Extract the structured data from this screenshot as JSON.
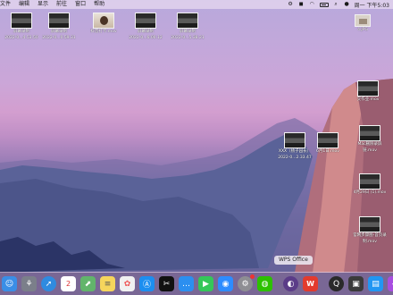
{
  "menubar": {
    "items": [
      "文件",
      "编辑",
      "显示",
      "前往",
      "窗口",
      "帮助"
    ],
    "clock": "周一 下午5:03"
  },
  "desktop_icons": [
    {
      "label1": "屏幕录制",
      "label2": "2022-0...4.53.50",
      "kind": "dark"
    },
    {
      "label1": "屏幕录制",
      "label2": "2022-0...0.59.31",
      "kind": "dark"
    },
    {
      "label1": "",
      "label2": "抖音打卡.mov",
      "kind": "face"
    },
    {
      "label1": "屏幕录制",
      "label2": "2022-0...6.00.12",
      "kind": "dark"
    },
    {
      "label1": "屏幕录制",
      "label2": "2022-0...5.38.21",
      "kind": "dark"
    },
    {
      "label1": "",
      "label2": "4.JPG",
      "kind": "img"
    },
    {
      "label1": "",
      "label2": "交作业.mov",
      "kind": "dark"
    },
    {
      "label1": "XXX（杨子园长）",
      "label2": "2022-0...2.33.47",
      "kind": "dark"
    },
    {
      "label1": "6月1日.mov",
      "label2": "",
      "kind": "dark"
    },
    {
      "label1": "Mac删除录屏",
      "label2": "链.mov",
      "kind": "dark"
    },
    {
      "label1": "",
      "label2": "4月29日 (1).mov",
      "kind": "dark"
    },
    {
      "label1": "官网步骤图-首页录",
      "label2": "制.mov",
      "kind": "dark"
    }
  ],
  "dock": {
    "tooltip": "WPS Office",
    "calendar_day": "2",
    "apps": [
      {
        "name": "finder",
        "color": "#3a8ee6"
      },
      {
        "name": "launchpad",
        "color": "#7b7f8a"
      },
      {
        "name": "safari",
        "color": "#2f8be0"
      },
      {
        "name": "calendar",
        "color": "#ffffff"
      },
      {
        "name": "maps",
        "color": "#62b56b"
      },
      {
        "name": "notes",
        "color": "#f6d55c"
      },
      {
        "name": "photos",
        "color": "#f0f0f0"
      },
      {
        "name": "app-store",
        "color": "#1c8ef0"
      },
      {
        "name": "capcut",
        "color": "#111111"
      },
      {
        "name": "messages-dots",
        "color": "#2b8ff0"
      },
      {
        "name": "facetime",
        "color": "#34c759"
      },
      {
        "name": "zoom",
        "color": "#2d8cff"
      },
      {
        "name": "system-preferences",
        "color": "#8e8e93"
      },
      {
        "name": "wechat",
        "color": "#2dc100"
      },
      {
        "name": "siri",
        "color": "#5b3c88"
      },
      {
        "name": "wps-office",
        "color": "#e33b2e"
      },
      {
        "name": "quicktime",
        "color": "#2a2a2a"
      },
      {
        "name": "screenshot",
        "color": "#3b3b3b"
      },
      {
        "name": "notes-app",
        "color": "#2196f3"
      },
      {
        "name": "shortcuts",
        "color": "#a84de0"
      },
      {
        "name": "preview",
        "color": "#cccccc"
      }
    ]
  }
}
